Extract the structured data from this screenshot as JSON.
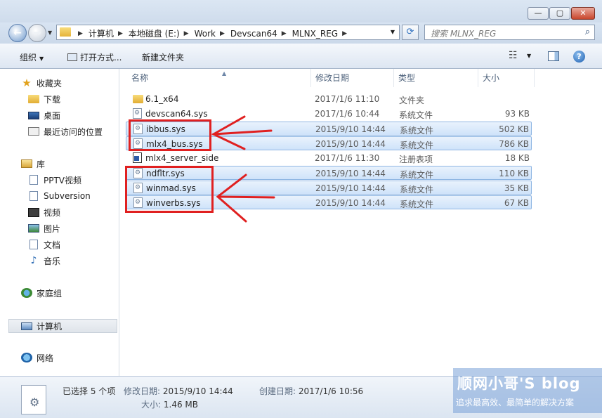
{
  "window": {
    "buttons": [
      "—",
      "▢",
      "✕"
    ]
  },
  "address": {
    "crumbs": [
      "计算机",
      "本地磁盘 (E:)",
      "Work",
      "Devscan64",
      "MLNX_REG"
    ],
    "search_placeholder": "搜索 MLNX_REG"
  },
  "toolbar": {
    "organize": "组织",
    "open_with": "打开方式...",
    "new_folder": "新建文件夹"
  },
  "nav": {
    "favorites": "收藏夹",
    "downloads": "下载",
    "desktop": "桌面",
    "recent": "最近访问的位置",
    "libraries": "库",
    "pptv": "PPTV视频",
    "subversion": "Subversion",
    "videos": "视频",
    "pictures": "图片",
    "documents": "文档",
    "music": "音乐",
    "homegroup": "家庭组",
    "computer": "计算机",
    "network": "网络"
  },
  "columns": {
    "name": "名称",
    "date": "修改日期",
    "type": "类型",
    "size": "大小"
  },
  "files": [
    {
      "name": "6.1_x64",
      "date": "2017/1/6 11:10",
      "type": "文件夹",
      "size": "",
      "icon": "folder-icon",
      "selected": false
    },
    {
      "name": "devscan64.sys",
      "date": "2017/1/6 10:44",
      "type": "系统文件",
      "size": "93 KB",
      "icon": "sys-file-icon",
      "selected": false
    },
    {
      "name": "ibbus.sys",
      "date": "2015/9/10 14:44",
      "type": "系统文件",
      "size": "502 KB",
      "icon": "sys-file-icon",
      "selected": true
    },
    {
      "name": "mlx4_bus.sys",
      "date": "2015/9/10 14:44",
      "type": "系统文件",
      "size": "786 KB",
      "icon": "sys-file-icon",
      "selected": true
    },
    {
      "name": "mlx4_server_side",
      "date": "2017/1/6 11:30",
      "type": "注册表项",
      "size": "18 KB",
      "icon": "reg-file-icon",
      "selected": false
    },
    {
      "name": "ndfltr.sys",
      "date": "2015/9/10 14:44",
      "type": "系统文件",
      "size": "110 KB",
      "icon": "sys-file-icon",
      "selected": true
    },
    {
      "name": "winmad.sys",
      "date": "2015/9/10 14:44",
      "type": "系统文件",
      "size": "35 KB",
      "icon": "sys-file-icon",
      "selected": true
    },
    {
      "name": "winverbs.sys",
      "date": "2015/9/10 14:44",
      "type": "系统文件",
      "size": "67 KB",
      "icon": "sys-file-icon",
      "selected": true
    }
  ],
  "details": {
    "selected_count": "已选择 5 个项",
    "modified_label": "修改日期:",
    "modified_value": "2015/9/10 14:44",
    "created_label": "创建日期:",
    "created_value": "2017/1/6 10:56",
    "size_label": "大小:",
    "size_value": "1.46 MB"
  },
  "watermark": {
    "title": "顺网小哥'S blog",
    "subtitle": "追求最高效、最简单的解决方案"
  },
  "colors": {
    "selection": "#cfe3fa",
    "annotation": "#e02020",
    "chrome": "#dbe6f3"
  }
}
